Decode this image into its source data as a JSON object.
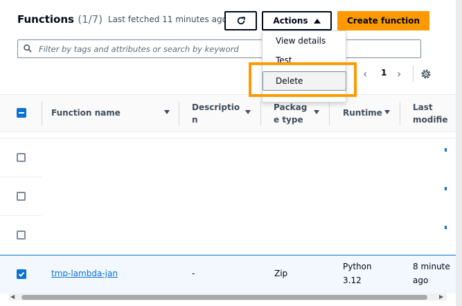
{
  "header": {
    "title": "Functions",
    "count": "(1/7)",
    "fetched": "Last fetched 11 minutes ago",
    "actions_label": "Actions",
    "create_label": "Create function"
  },
  "search": {
    "placeholder": "Filter by tags and attributes or search by keyword"
  },
  "pagination": {
    "page": "1"
  },
  "table": {
    "columns": [
      {
        "l1": "Function name",
        "l2": ""
      },
      {
        "l1": "Descriptio",
        "l2": "n"
      },
      {
        "l1": "Packag",
        "l2": "e type"
      },
      {
        "l1": "Runtime",
        "l2": ""
      },
      {
        "l1": "Last",
        "l2": "modifie"
      }
    ],
    "selected_row": {
      "function_name": "tmp-lambda-jan",
      "description": "-",
      "package_type": "Zip",
      "runtime_l1": "Python",
      "runtime_l2": "3.12",
      "modified_l1": "8 minute",
      "modified_l2": "ago"
    }
  },
  "dropdown": {
    "items": [
      "View details",
      "Test",
      "Delete"
    ]
  },
  "colors": {
    "accent": "#ff9900",
    "link": "#0972d3"
  }
}
